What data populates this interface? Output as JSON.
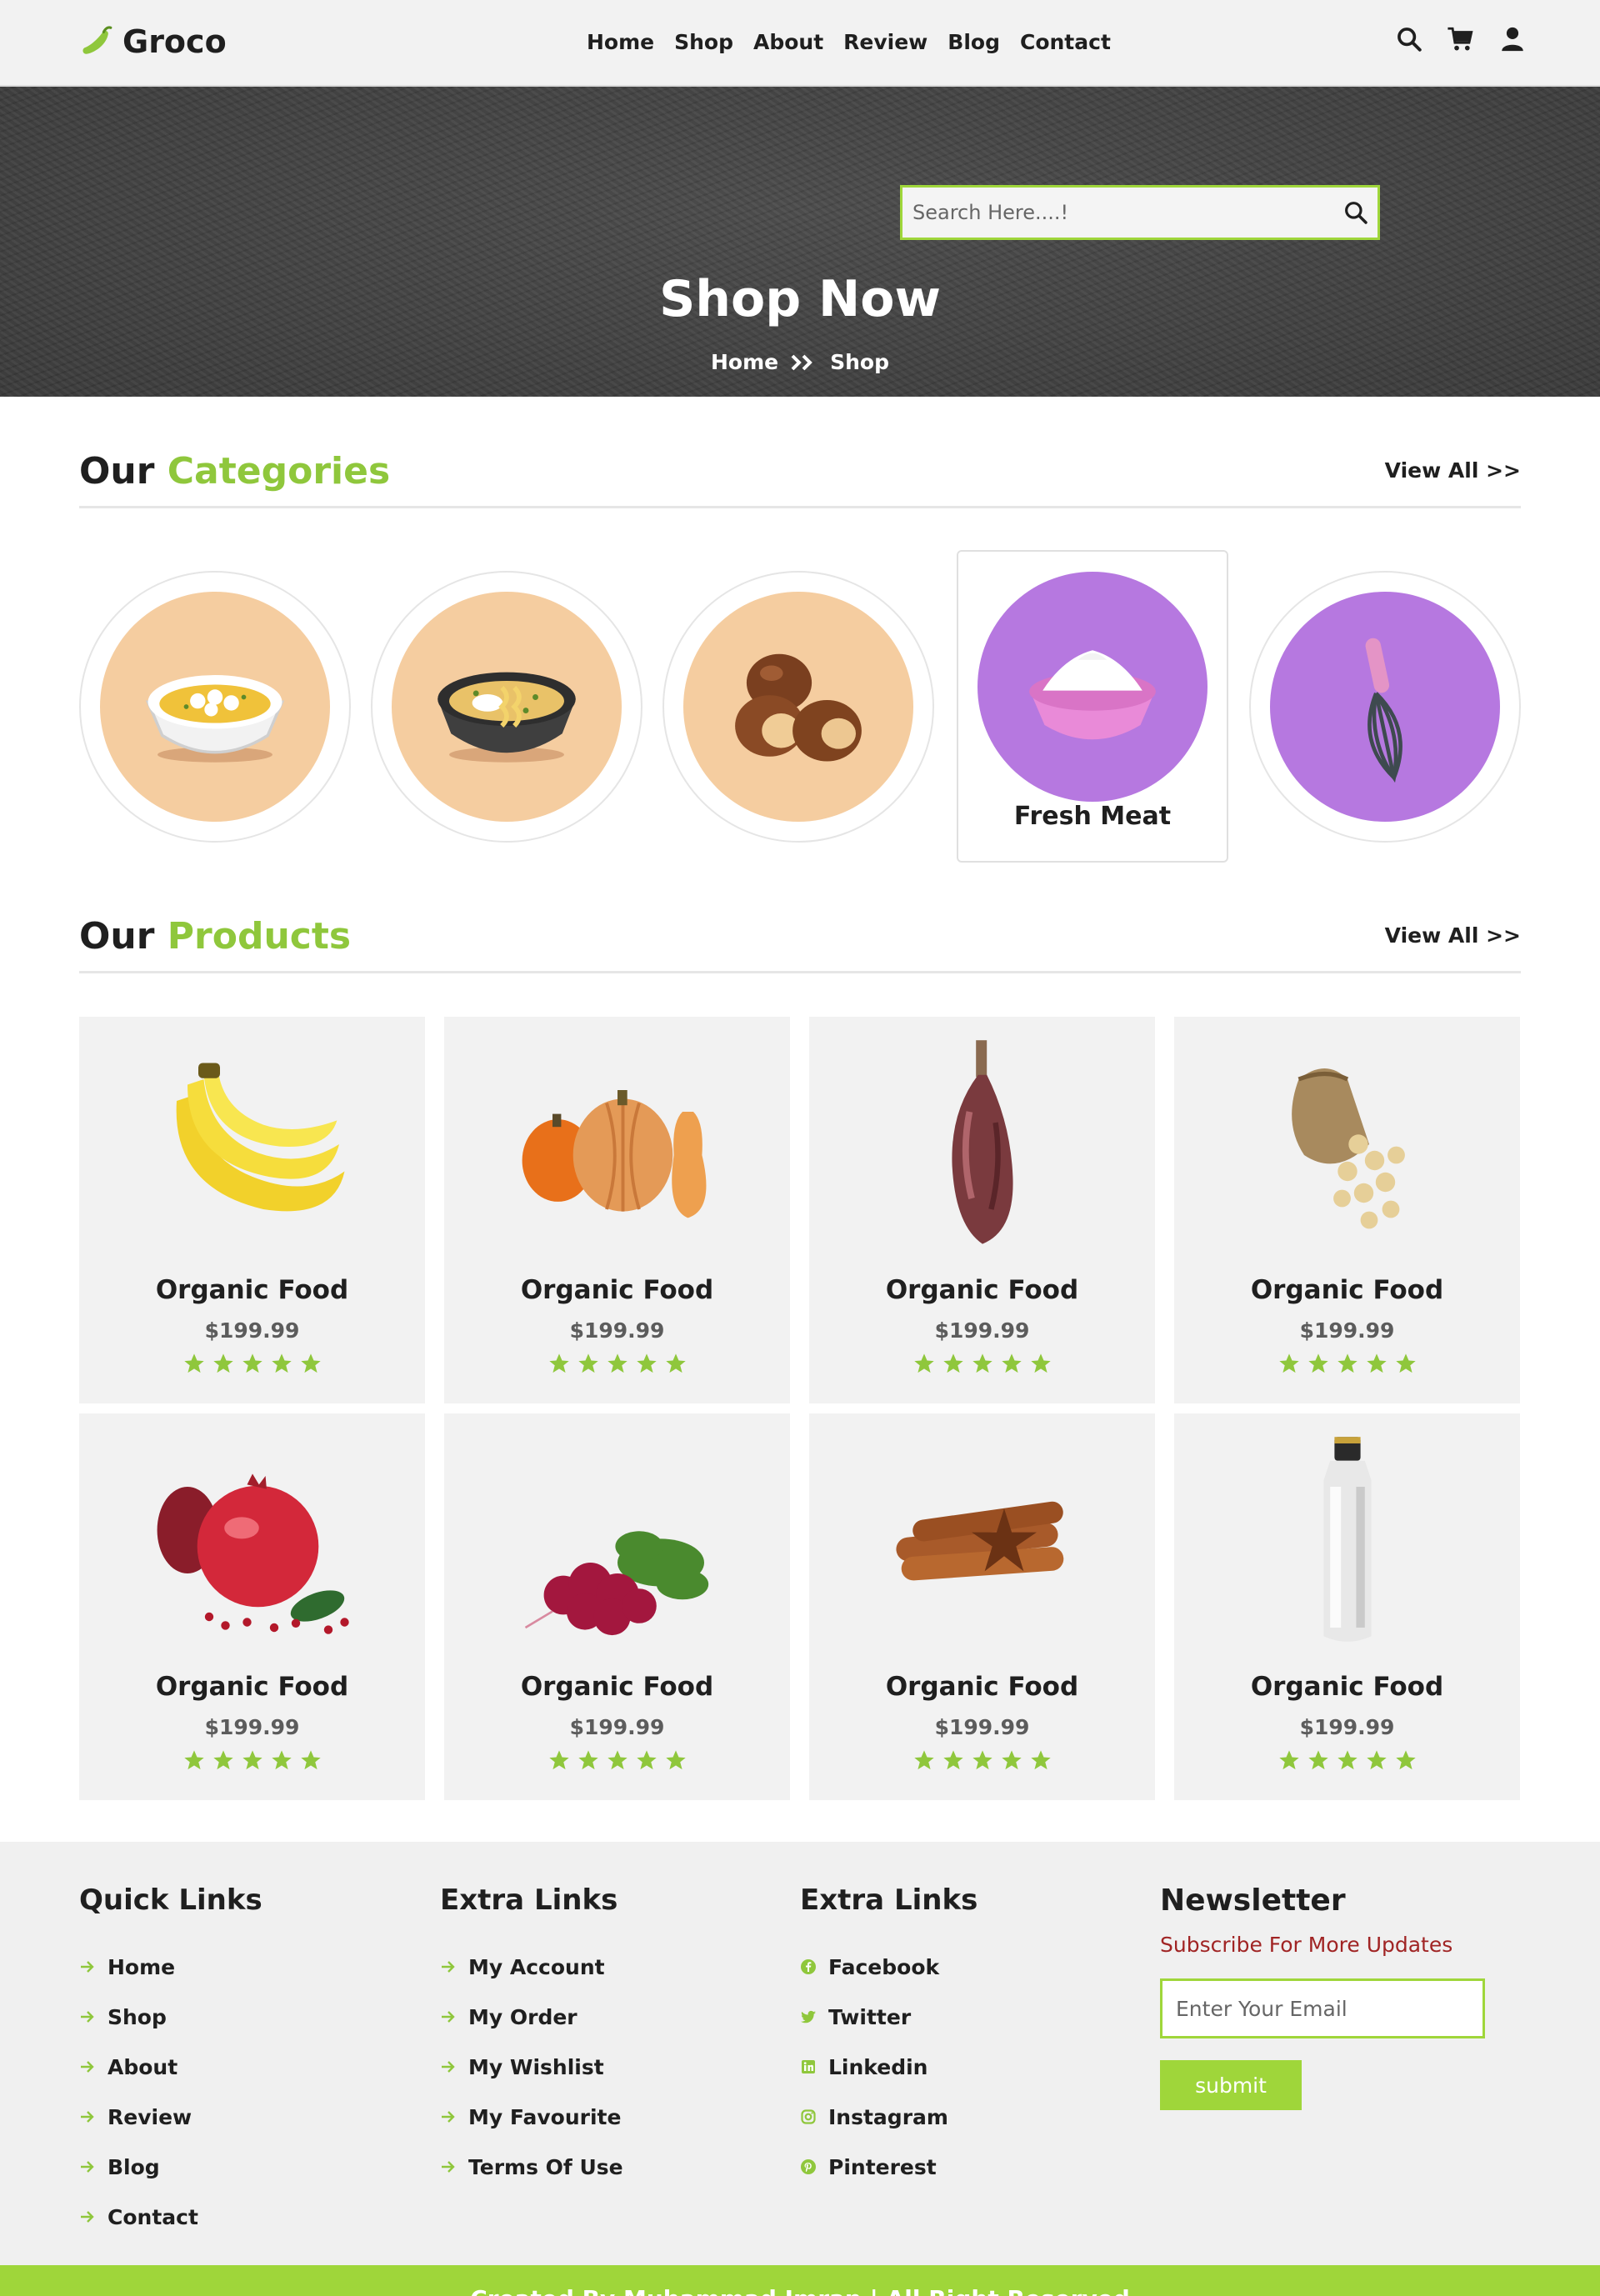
{
  "header": {
    "logo_text": "Groco",
    "nav": [
      "Home",
      "Shop",
      "About",
      "Review",
      "Blog",
      "Contact"
    ],
    "icons": [
      "search-icon",
      "cart-icon",
      "user-icon"
    ]
  },
  "hero": {
    "search_placeholder": "Search Here....!",
    "title": "Shop Now",
    "breadcrumb_home": "Home",
    "breadcrumb_current": "Shop"
  },
  "categories": {
    "title_plain": "Our",
    "title_accent": "Categories",
    "view_all": "View All >>",
    "items": [
      {
        "image": "yellow-soup-bowl",
        "bg": "#f5cda0"
      },
      {
        "image": "noodle-soup-bowl",
        "bg": "#f5cda0"
      },
      {
        "image": "chestnuts",
        "bg": "#f5cda0"
      },
      {
        "image": "flour-bowl",
        "bg": "#b678e0",
        "label": "Fresh Meat"
      },
      {
        "image": "whisk",
        "bg": "#b678e0"
      }
    ]
  },
  "products": {
    "title_plain": "Our",
    "title_accent": "Products",
    "view_all": "View All >>",
    "rating": 5,
    "items": [
      {
        "image": "banana",
        "name": "Organic Food",
        "price": "$199.99"
      },
      {
        "image": "pumpkins",
        "name": "Organic Food",
        "price": "$199.99"
      },
      {
        "image": "meat-leg",
        "name": "Organic Food",
        "price": "$199.99"
      },
      {
        "image": "cashew-sack",
        "name": "Organic Food",
        "price": "$199.99"
      },
      {
        "image": "pomegranate",
        "name": "Organic Food",
        "price": "$199.99"
      },
      {
        "image": "radishes",
        "name": "Organic Food",
        "price": "$199.99"
      },
      {
        "image": "cinnamon",
        "name": "Organic Food",
        "price": "$199.99"
      },
      {
        "image": "bottle",
        "name": "Organic Food",
        "price": "$199.99"
      }
    ]
  },
  "footer": {
    "quick_links": {
      "title": "Quick Links",
      "items": [
        "Home",
        "Shop",
        "About",
        "Review",
        "Blog",
        "Contact"
      ]
    },
    "extra_links": {
      "title": "Extra Links",
      "items": [
        "My Account",
        "My Order",
        "My Wishlist",
        "My Favourite",
        "Terms Of Use"
      ]
    },
    "social_links": {
      "title": "Extra Links",
      "items": [
        {
          "label": "Facebook",
          "icon": "facebook-icon"
        },
        {
          "label": "Twitter",
          "icon": "twitter-icon"
        },
        {
          "label": "Linkedin",
          "icon": "linkedin-icon"
        },
        {
          "label": "Instagram",
          "icon": "instagram-icon"
        },
        {
          "label": "Pinterest",
          "icon": "pinterest-icon"
        }
      ]
    },
    "newsletter": {
      "title": "Newsletter",
      "subtitle": "Subscribe For More Updates",
      "email_placeholder": "Enter Your Email",
      "submit_label": "submit"
    }
  },
  "copyright": "Created By Muhammad Imran | All Right Reserved",
  "colors": {
    "accent": "#9fd63a",
    "accent_text": "#8fc73c",
    "dark": "#1f1f1f",
    "footer_bg": "#f0f0f0",
    "card_bg": "#f2f2f2",
    "peach": "#f5cda0",
    "purple": "#b678e0"
  }
}
